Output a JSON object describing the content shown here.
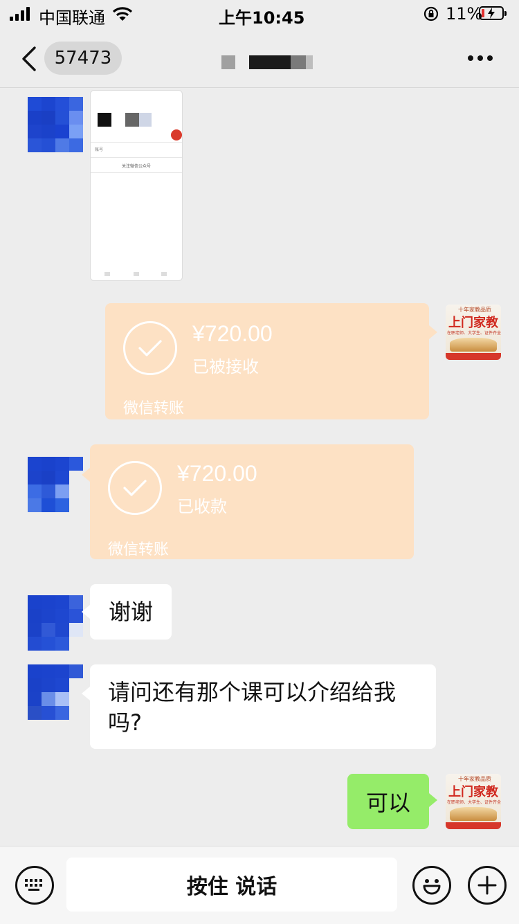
{
  "status_bar": {
    "carrier": "中国联通",
    "time": "上午10:45",
    "battery_percent": "11%"
  },
  "nav": {
    "unread_count": "57473",
    "more_icon": "more-dots-icon",
    "back_icon": "chevron-left-icon"
  },
  "messages": {
    "transfer_sent": {
      "amount": "¥720.00",
      "status": "已被接收",
      "footer": "微信转账"
    },
    "transfer_received": {
      "amount": "¥720.00",
      "status": "已收款",
      "footer": "微信转账"
    },
    "text_thanks": "谢谢",
    "text_question_line1": "请问还有那个课可以介绍给我",
    "text_question_line2": "吗?",
    "text_reply": "可以"
  },
  "ad_avatar": {
    "top": "十年家教品质",
    "title": "上门家教",
    "subtitle": "在职老师、大学生、证件齐全"
  },
  "screenshot_thumb": {
    "row_label": "账号",
    "button": "关注微信公众号"
  },
  "input_bar": {
    "talk_label": "按住 说话",
    "keyboard_icon": "keyboard-icon",
    "emoji_icon": "emoji-icon",
    "plus_icon": "plus-circle-icon"
  },
  "colors": {
    "background": "#ededed",
    "transfer_orange": "#fde1c4",
    "outgoing_green": "#95ec69"
  }
}
